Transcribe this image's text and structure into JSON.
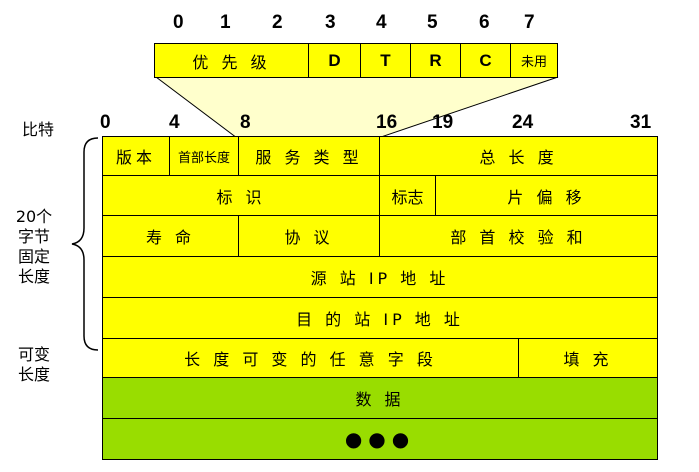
{
  "tos_bits": [
    "0",
    "1",
    "2",
    "3",
    "4",
    "5",
    "6",
    "7"
  ],
  "tos_fields": {
    "priority": "优 先 级",
    "d": "D",
    "t": "T",
    "r": "R",
    "c": "C",
    "unused": "未用"
  },
  "bit_label": "比特",
  "bits": [
    "0",
    "4",
    "8",
    "16",
    "19",
    "24",
    "31"
  ],
  "side_labels": {
    "fixed_line1": "20个",
    "fixed_line2": "字节",
    "fixed_line3": "固定",
    "fixed_line4": "长度",
    "var_line1": "可变",
    "var_line2": "长度"
  },
  "header": {
    "version": "版本",
    "header_length": "首部长度",
    "service_type": "服 务 类 型",
    "total_length": "总 长 度",
    "identification": "标 识",
    "flags": "标志",
    "fragment_offset": "片 偏 移",
    "ttl": "寿 命",
    "protocol": "协 议",
    "checksum": "部 首 校 验 和",
    "source_ip": "源 站 IP 地 址",
    "dest_ip": "目 的 站 IP 地 址",
    "options": "长 度 可 变 的 任 意 字 段",
    "padding": "填 充"
  },
  "data_label": "数 据",
  "ellipsis": "●●●",
  "colors": {
    "header_fill": "#ffff00",
    "data_fill": "#99dd00",
    "callout_fill": "#ffffcc"
  }
}
